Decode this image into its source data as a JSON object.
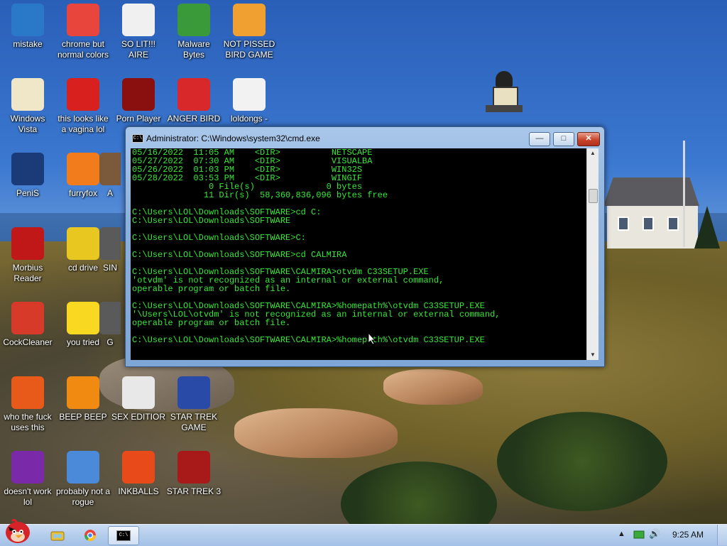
{
  "desktop": {
    "icons": [
      {
        "label": "mistake",
        "icon": "monitor-icon",
        "color": "#2a78c8"
      },
      {
        "label": "chrome but normal colors",
        "icon": "chrome-icon",
        "color": "#e8453c"
      },
      {
        "label": "SO LIT!!! AIRE",
        "icon": "cards-icon",
        "color": "#f0f0f0"
      },
      {
        "label": "Malware Bytes",
        "icon": "shield-icon",
        "color": "#3a9a3a"
      },
      {
        "label": "NOT PISSED BIRD GAME",
        "icon": "green-pig-icon",
        "color": "#f0a030"
      },
      {
        "label": "Windows Vista",
        "icon": "egg-icon",
        "color": "#f0e6c8"
      },
      {
        "label": "this looks like a vagina lol",
        "icon": "opera-icon",
        "color": "#d8201e"
      },
      {
        "label": "Porn Player",
        "icon": "flash-icon",
        "color": "#8a1010"
      },
      {
        "label": "ANGER BIRD",
        "icon": "angry-bird-icon",
        "color": "#d8282a"
      },
      {
        "label": "loldongs -",
        "icon": "document-icon",
        "color": "#f2f2f2"
      },
      {
        "label": "PeniS",
        "icon": "photoshop-icon",
        "color": "#1a3a78"
      },
      {
        "label": "furryfox",
        "icon": "firefox-icon",
        "color": "#f27b1c"
      },
      {
        "label": "A",
        "icon": "partial-icon",
        "color": "#7a5a3a"
      },
      {
        "label": "Morbius Reader",
        "icon": "pdf-icon",
        "color": "#c01818"
      },
      {
        "label": "cd drive",
        "icon": "cd-icon",
        "color": "#e8c820"
      },
      {
        "label": "SIN",
        "icon": "partial-icon",
        "color": "#5a5a5a"
      },
      {
        "label": "CockCleaner",
        "icon": "ccleaner-icon",
        "color": "#d83a2a"
      },
      {
        "label": "you tried",
        "icon": "star-icon",
        "color": "#f8d820"
      },
      {
        "label": "G",
        "icon": "partial-icon",
        "color": "#5a5a5a"
      },
      {
        "label": "who the fuck uses this",
        "icon": "lightning-icon",
        "color": "#e85a1a"
      },
      {
        "label": "BEEP BEEP",
        "icon": "vlc-icon",
        "color": "#f08a10"
      },
      {
        "label": "SEX EDITIOR",
        "icon": "hxd-icon",
        "color": "#e8e8e8"
      },
      {
        "label": "STAR TREK GAME",
        "icon": "star-trek-game-icon",
        "color": "#2a4aa8"
      },
      {
        "label": "doesn't work lol",
        "icon": "yahoo-icon",
        "color": "#7a2aa8"
      },
      {
        "label": "probably not a rogue",
        "icon": "gear-monitor-icon",
        "color": "#4a8ad8"
      },
      {
        "label": "INKBALLS",
        "icon": "inkball-icon",
        "color": "#e84a1a"
      },
      {
        "label": "STAR TREK 3",
        "icon": "star-trek-3-icon",
        "color": "#a81a1a"
      }
    ]
  },
  "cmd": {
    "title": "Administrator: C:\\Windows\\system32\\cmd.exe",
    "icon_text": "C:\\",
    "buttons": {
      "minimize": "—",
      "maximize": "□",
      "close": "✕"
    },
    "lines": [
      "05/16/2022  11:05 AM    <DIR>          NETSCAPE",
      "05/27/2022  07:30 AM    <DIR>          VISUALBA",
      "05/26/2022  01:03 PM    <DIR>          WIN32S",
      "05/28/2022  03:53 PM    <DIR>          WINGIF",
      "               0 File(s)              0 bytes",
      "              11 Dir(s)  58,360,836,096 bytes free",
      "",
      "C:\\Users\\LOL\\Downloads\\SOFTWARE>cd C:",
      "C:\\Users\\LOL\\Downloads\\SOFTWARE",
      "",
      "C:\\Users\\LOL\\Downloads\\SOFTWARE>C:",
      "",
      "C:\\Users\\LOL\\Downloads\\SOFTWARE>cd CALMIRA",
      "",
      "C:\\Users\\LOL\\Downloads\\SOFTWARE\\CALMIRA>otvdm C33SETUP.EXE",
      "'otvdm' is not recognized as an internal or external command,",
      "operable program or batch file.",
      "",
      "C:\\Users\\LOL\\Downloads\\SOFTWARE\\CALMIRA>%homepath%\\otvdm C33SETUP.EXE",
      "'\\Users\\LOL\\otvdm' is not recognized as an internal or external command,",
      "operable program or batch file.",
      "",
      "C:\\Users\\LOL\\Downloads\\SOFTWARE\\CALMIRA>%homepath%\\otvdm C33SETUP.EXE"
    ]
  },
  "taskbar": {
    "start_icon": "angry-bird-start-icon",
    "buttons": [
      {
        "icon": "explorer-icon"
      },
      {
        "icon": "chrome-icon"
      },
      {
        "icon": "cmd-icon",
        "active": true
      }
    ],
    "tray": {
      "show_hidden": "▲",
      "volume": "🔊"
    },
    "clock": "9:25 AM"
  }
}
